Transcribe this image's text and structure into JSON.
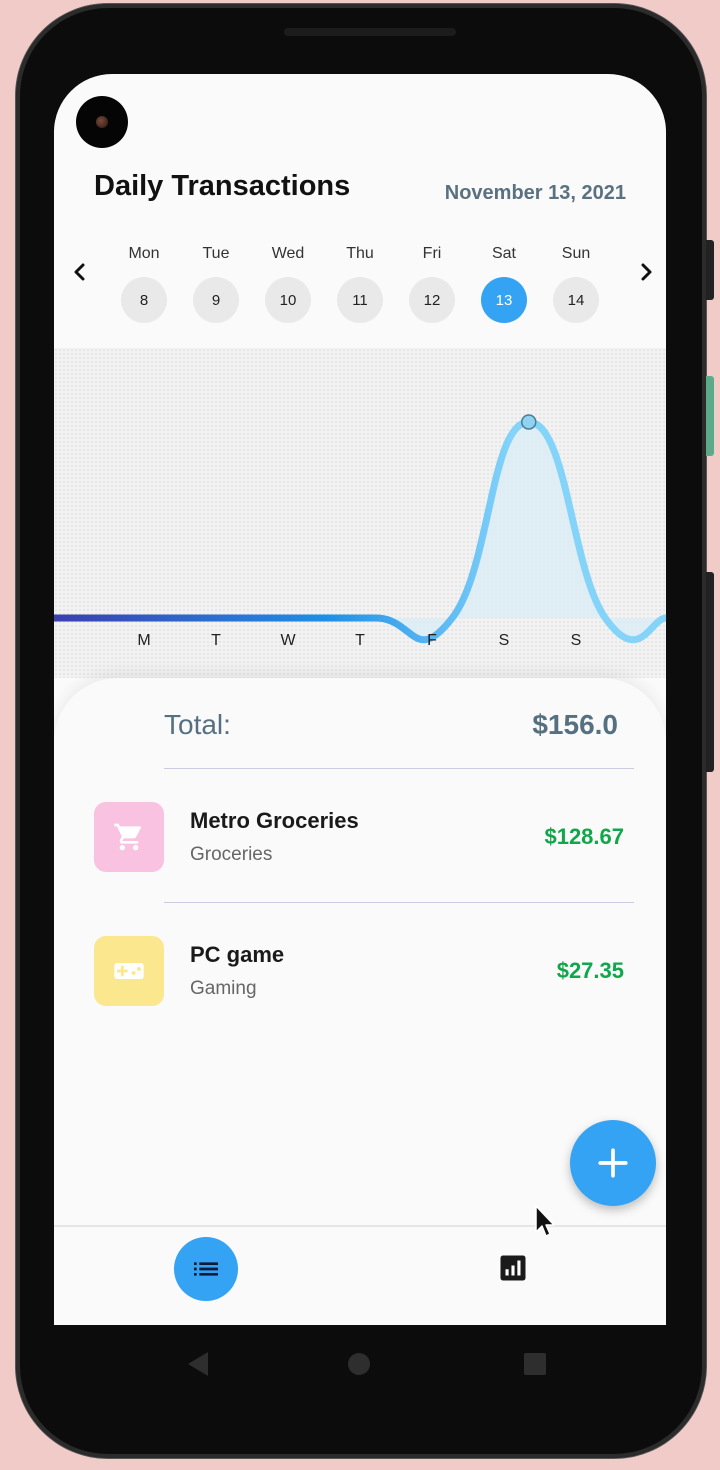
{
  "app": {
    "title": "Daily Transactions",
    "date": "November 13, 2021"
  },
  "week": {
    "days": [
      {
        "name": "Mon",
        "num": "8"
      },
      {
        "name": "Tue",
        "num": "9"
      },
      {
        "name": "Wed",
        "num": "10"
      },
      {
        "name": "Thu",
        "num": "11"
      },
      {
        "name": "Fri",
        "num": "12"
      },
      {
        "name": "Sat",
        "num": "13"
      },
      {
        "name": "Sun",
        "num": "14"
      }
    ],
    "selected_index": 5,
    "prev_icon": "chevron-left-icon",
    "next_icon": "chevron-right-icon"
  },
  "chart": {
    "x_labels": [
      "M",
      "T",
      "W",
      "T",
      "F",
      "S",
      "S"
    ]
  },
  "chart_data": {
    "type": "line",
    "categories": [
      "M",
      "T",
      "W",
      "T",
      "F",
      "S",
      "S"
    ],
    "values": [
      0,
      0,
      0,
      0,
      0,
      156.0,
      0
    ],
    "title": "",
    "xlabel": "",
    "ylabel": "",
    "smooth": true,
    "highlighted_point": "S",
    "colors": {
      "line_start": "#3b3fb0",
      "line_end": "#84d4fa",
      "fill": "#dcedf6"
    }
  },
  "summary": {
    "total_label": "Total:",
    "total_value": "$156.0"
  },
  "transactions": [
    {
      "name": "Metro Groceries",
      "category": "Groceries",
      "amount": "$128.67",
      "icon": "shopping-cart-icon",
      "icon_bg": "#f8c2e0"
    },
    {
      "name": "PC game",
      "category": "Gaming",
      "amount": "$27.35",
      "icon": "gamepad-icon",
      "icon_bg": "#fbe78e"
    }
  ],
  "fab": {
    "icon": "plus-icon"
  },
  "bottom_nav": {
    "items": [
      {
        "icon": "list-icon",
        "active": true
      },
      {
        "icon": "bar-chart-icon",
        "active": false
      }
    ]
  },
  "system_nav": [
    "back-icon",
    "home-icon",
    "recents-icon"
  ],
  "colors": {
    "accent": "#34a3f4",
    "amount_green": "#10a64a",
    "slate": "#557080"
  }
}
